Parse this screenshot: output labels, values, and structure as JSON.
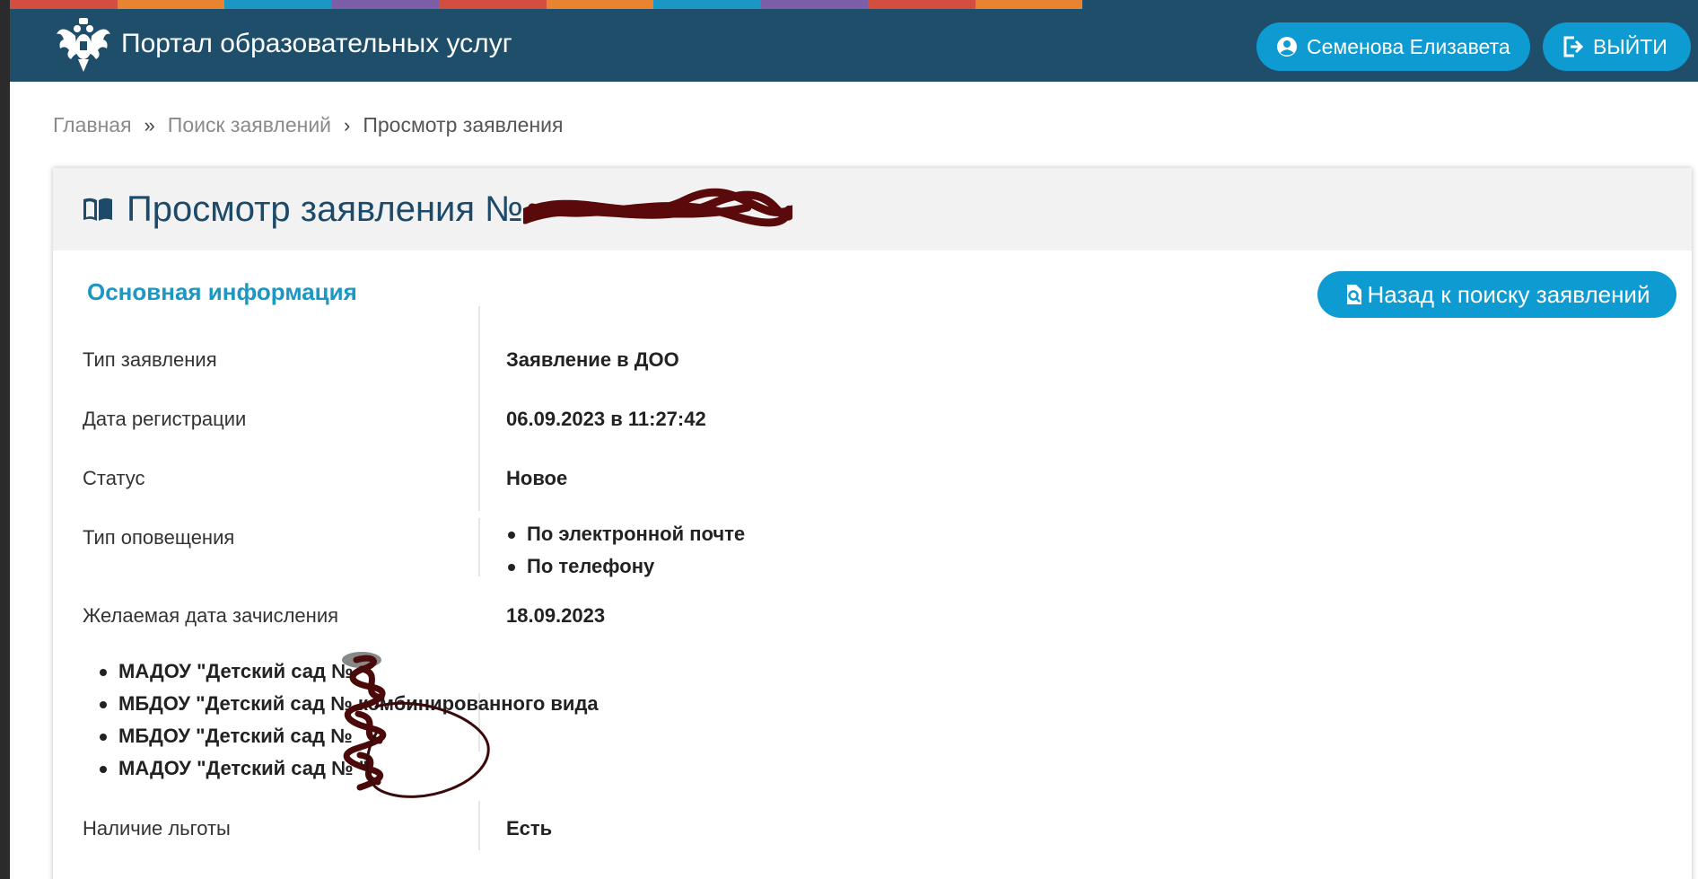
{
  "header": {
    "portal_title": "Портал образовательных услуг",
    "user_name": "Семенова Елизавета",
    "logout_label": "ВЫЙТИ",
    "stripe_colors": [
      "#d24f3f",
      "#e8832f",
      "#1b96c5",
      "#7b5ea7",
      "#d24f3f",
      "#e8832f",
      "#1b96c5",
      "#7b5ea7",
      "#d24f3f",
      "#e8832f"
    ]
  },
  "breadcrumb": {
    "home": "Главная",
    "search": "Поиск заявлений",
    "current": "Просмотр заявления"
  },
  "card": {
    "title": "Просмотр заявления №",
    "section_title": "Основная информация",
    "back_button": "Назад к поиску заявлений"
  },
  "details": {
    "type_label": "Тип заявления",
    "type_value": "Заявление в ДОО",
    "reg_date_label": "Дата регистрации",
    "reg_date_value": "06.09.2023 в 11:27:42",
    "status_label": "Статус",
    "status_value": "Новое",
    "notify_label": "Тип оповещения",
    "notify_values": [
      "По электронной почте",
      "По телефону"
    ],
    "enroll_label": "Желаемая дата зачисления",
    "enroll_value": "18.09.2023",
    "kindergartens": [
      "МАДОУ \"Детский сад №",
      "МБДОУ \"Детский сад №      комбинированного вида",
      "МБДОУ \"Детский сад №",
      "МАДОУ \"Детский сад №      \""
    ],
    "benefit_label": "Наличие льготы",
    "benefit_value": "Есть"
  },
  "icons": {
    "emblem": "coat-of-arms-icon",
    "user": "user-circle-icon",
    "logout": "logout-icon",
    "book": "open-book-icon",
    "search_doc": "search-document-icon"
  }
}
